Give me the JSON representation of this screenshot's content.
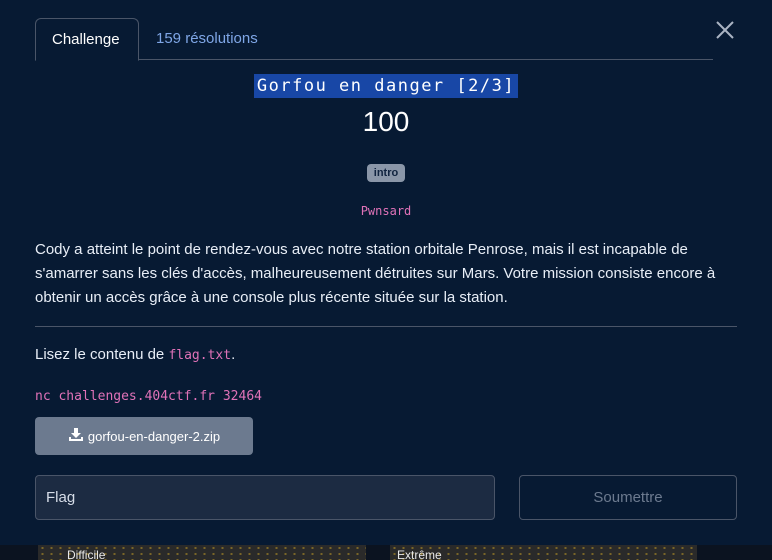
{
  "tabs": [
    {
      "label": "Challenge"
    },
    {
      "label": "159 résolutions"
    }
  ],
  "challenge": {
    "title": "Gorfou en danger [2/3]",
    "points": "100",
    "category": "intro",
    "author": "Pwnsard",
    "description": "Cody a atteint le point de rendez-vous avec notre station orbitale Penrose, mais il est incapable de s'amarrer sans les clés d'accès, malheureusement détruites sur Mars. Votre mission consiste encore à obtenir un accès grâce à une console plus récente située sur la station.",
    "instruction_prefix": "Lisez le contenu de ",
    "instruction_file": "flag.txt",
    "instruction_suffix": ".",
    "command": "nc challenges.404ctf.fr 32464",
    "attachment": "gorfou-en-danger-2.zip"
  },
  "form": {
    "flag_placeholder": "Flag",
    "submit_label": "Soumettre"
  },
  "background_cards": [
    {
      "label": "Difficile"
    },
    {
      "label": "Extrême"
    }
  ],
  "colors": {
    "background": "#071a33",
    "title_highlight": "#1847a6",
    "code": "#e072b8",
    "link": "#7fa6e6",
    "download_button": "#6c7a8f"
  },
  "icons": {
    "close": "close-icon",
    "download": "download-icon"
  }
}
